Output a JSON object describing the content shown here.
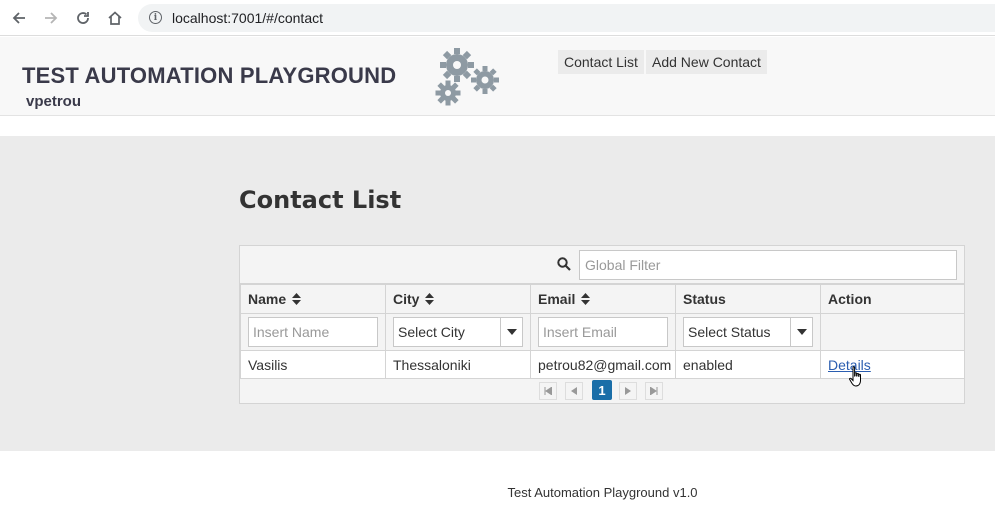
{
  "browser": {
    "url": "localhost:7001/#/contact"
  },
  "header": {
    "title": "TEST AUTOMATION PLAYGROUND",
    "user": "vpetrou",
    "nav": [
      "Contact List",
      "Add New Contact"
    ]
  },
  "page": {
    "title": "Contact List"
  },
  "table": {
    "global_filter_placeholder": "Global Filter",
    "columns": [
      "Name",
      "City",
      "Email",
      "Status",
      "Action"
    ],
    "filters": {
      "name_placeholder": "Insert Name",
      "city_select": "Select City",
      "email_placeholder": "Insert Email",
      "status_select": "Select Status"
    },
    "rows": [
      {
        "name": "Vasilis",
        "city": "Thessaloniki",
        "email": "petrou82@gmail.com",
        "status": "enabled",
        "action": "Details"
      }
    ],
    "current_page": "1"
  },
  "footer": {
    "text": "Test Automation Playground v1.0"
  },
  "colors": {
    "accent": "#1a6ea8",
    "status_enabled": "#2e7d32",
    "link": "#2a5db0"
  }
}
